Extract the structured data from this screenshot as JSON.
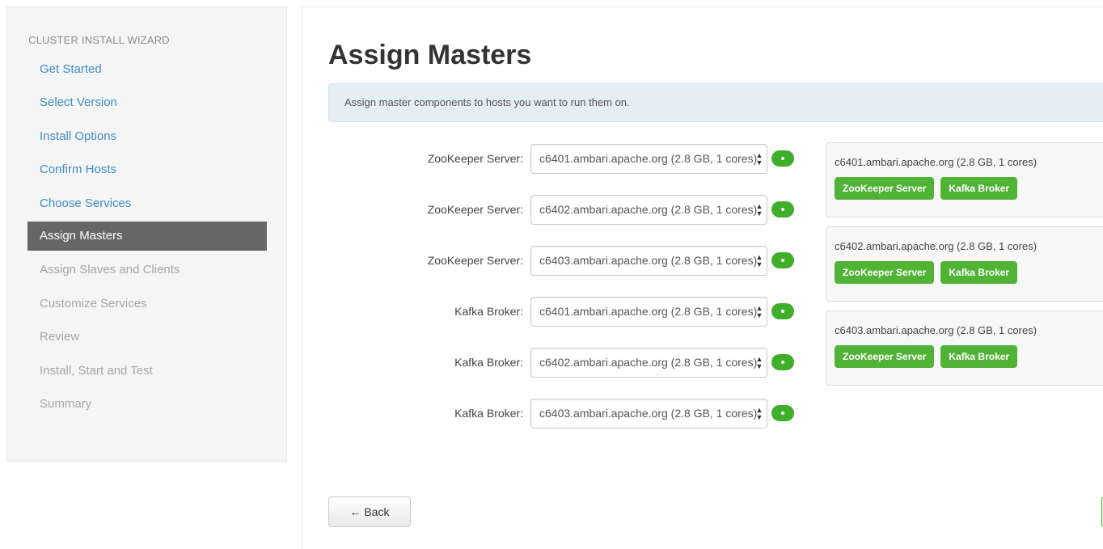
{
  "sidebar": {
    "header": "CLUSTER INSTALL WIZARD",
    "items": [
      {
        "label": "Get Started",
        "state": "done"
      },
      {
        "label": "Select Version",
        "state": "done"
      },
      {
        "label": "Install Options",
        "state": "done"
      },
      {
        "label": "Confirm Hosts",
        "state": "done"
      },
      {
        "label": "Choose Services",
        "state": "done"
      },
      {
        "label": "Assign Masters",
        "state": "active"
      },
      {
        "label": "Assign Slaves and Clients",
        "state": "todo"
      },
      {
        "label": "Customize Services",
        "state": "todo"
      },
      {
        "label": "Review",
        "state": "todo"
      },
      {
        "label": "Install, Start and Test",
        "state": "todo"
      },
      {
        "label": "Summary",
        "state": "todo"
      }
    ]
  },
  "main": {
    "title": "Assign Masters",
    "info": "Assign master components to hosts you want to run them on.",
    "assignments": [
      {
        "label": "ZooKeeper Server:",
        "host": "c6401.ambari.apache.org (2.8 GB, 1 cores)"
      },
      {
        "label": "ZooKeeper Server:",
        "host": "c6402.ambari.apache.org (2.8 GB, 1 cores)"
      },
      {
        "label": "ZooKeeper Server:",
        "host": "c6403.ambari.apache.org (2.8 GB, 1 cores)"
      },
      {
        "label": "Kafka Broker:",
        "host": "c6401.ambari.apache.org (2.8 GB, 1 cores)"
      },
      {
        "label": "Kafka Broker:",
        "host": "c6402.ambari.apache.org (2.8 GB, 1 cores)"
      },
      {
        "label": "Kafka Broker:",
        "host": "c6403.ambari.apache.org (2.8 GB, 1 cores)"
      }
    ],
    "hosts": [
      {
        "name": "c6401.ambari.apache.org (2.8 GB, 1 cores)",
        "components": [
          "ZooKeeper Server",
          "Kafka Broker"
        ]
      },
      {
        "name": "c6402.ambari.apache.org (2.8 GB, 1 cores)",
        "components": [
          "ZooKeeper Server",
          "Kafka Broker"
        ]
      },
      {
        "name": "c6403.ambari.apache.org (2.8 GB, 1 cores)",
        "components": [
          "ZooKeeper Server",
          "Kafka Broker"
        ]
      }
    ],
    "back_label": "← Back"
  },
  "colors": {
    "link": "#3c8dc5",
    "active_nav": "#666666",
    "success": "#51b336",
    "info_bg": "#e4eef5"
  },
  "icons": {
    "select_arrows": "up-down-arrows-icon",
    "add": "plus-icon"
  }
}
